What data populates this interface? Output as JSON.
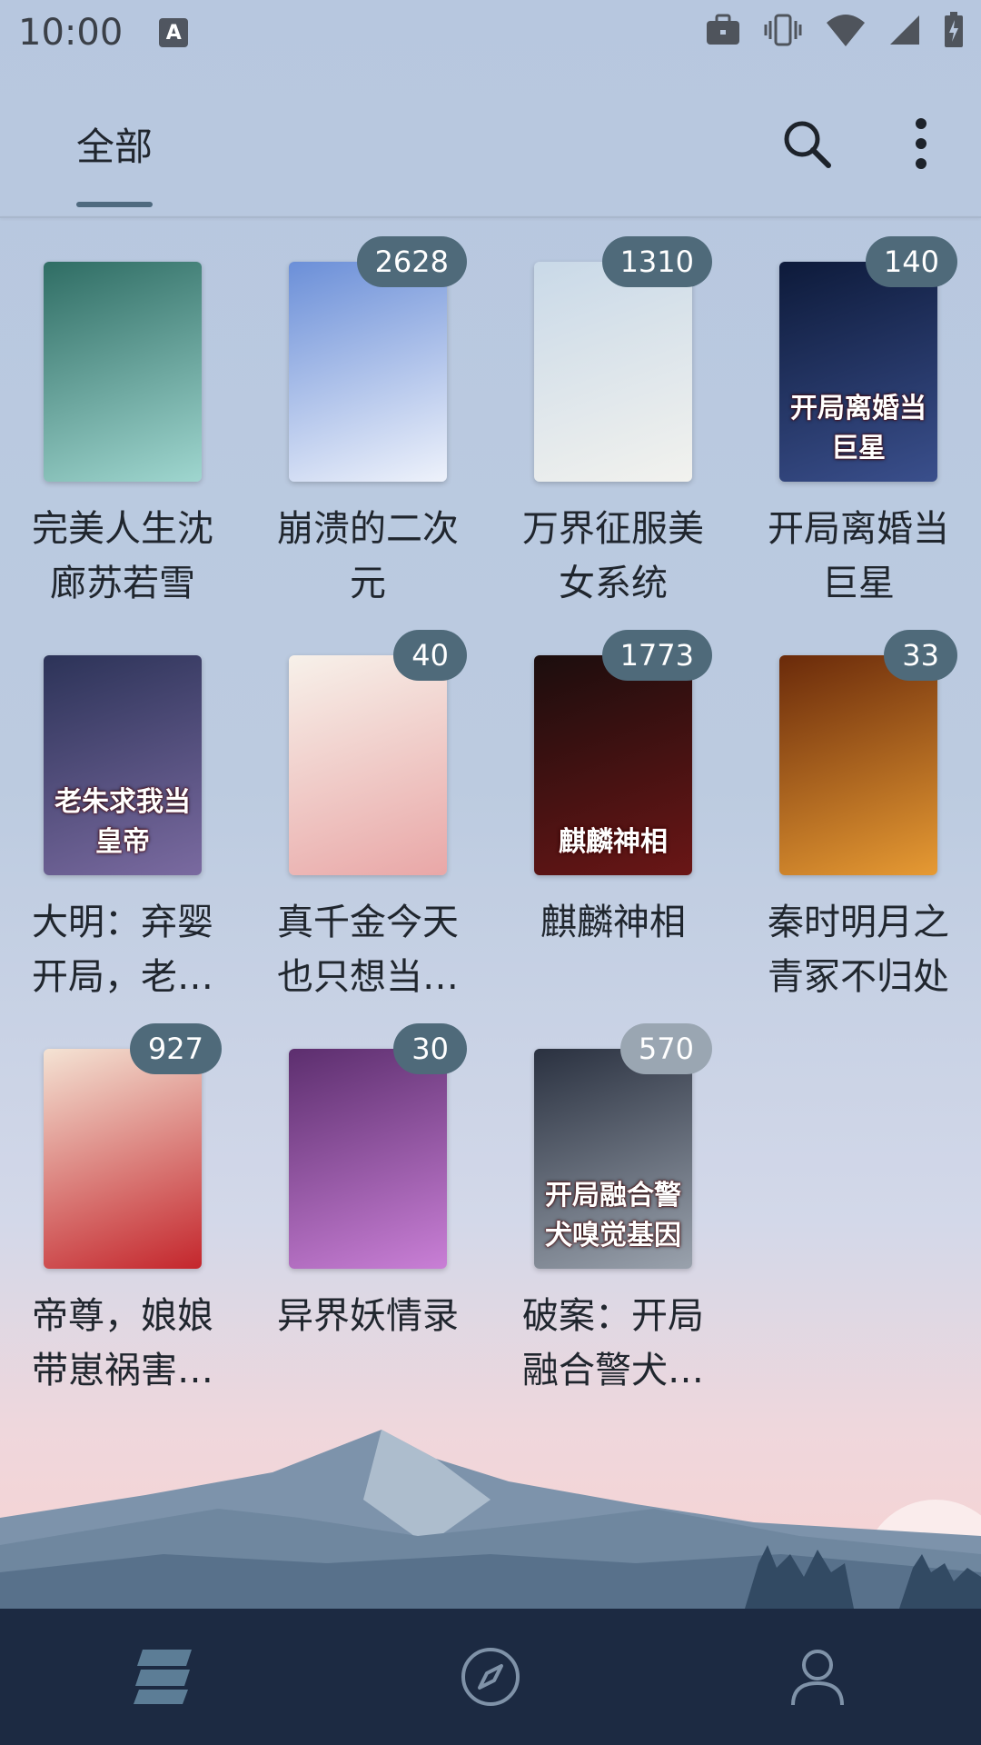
{
  "status_bar": {
    "time": "10:00",
    "a_icon": "A"
  },
  "header": {
    "tab_label": "全部",
    "search_icon": "search-icon",
    "more_icon": "more-vert-icon"
  },
  "books": [
    {
      "title": "完美人生沈廊苏若雪",
      "badge": "",
      "cover_text": "",
      "colors": [
        "#2f6d64",
        "#9fd6cf"
      ]
    },
    {
      "title": "崩溃的二次元",
      "badge": "2628",
      "cover_text": "",
      "colors": [
        "#6b8fd8",
        "#eef2fb"
      ]
    },
    {
      "title": "万界征服美女系统",
      "badge": "1310",
      "cover_text": "",
      "colors": [
        "#c9d9e8",
        "#f2f2ee"
      ]
    },
    {
      "title": "开局离婚当巨星",
      "badge": "140",
      "cover_text": "开局离婚当巨星",
      "colors": [
        "#0d1a3a",
        "#3a4f8c"
      ]
    },
    {
      "title": "大明：弃婴开局，老朱求我当皇帝",
      "badge": "",
      "cover_text": "老朱求我当皇帝",
      "colors": [
        "#2c3358",
        "#7a6aa0"
      ]
    },
    {
      "title": "真千金今天也只想当咸鱼",
      "badge": "40",
      "cover_text": "",
      "colors": [
        "#f7f1ea",
        "#e9a7a7"
      ]
    },
    {
      "title": "麒麟神相",
      "badge": "1773",
      "cover_text": "麒麟神相",
      "colors": [
        "#1b0d0d",
        "#6a1616"
      ]
    },
    {
      "title": "秦时明月之青冢不归处",
      "badge": "33",
      "cover_text": "",
      "colors": [
        "#6a2a0a",
        "#e69a33"
      ]
    },
    {
      "title": "帝尊，娘娘带崽祸害三界了",
      "badge": "927",
      "cover_text": "",
      "colors": [
        "#f4e3d4",
        "#c4262c"
      ]
    },
    {
      "title": "异界妖情录",
      "badge": "30",
      "cover_text": "",
      "colors": [
        "#5c2e6e",
        "#c97fd6"
      ]
    },
    {
      "title": "破案：开局融合警犬嗅觉基因",
      "badge": "570",
      "cover_text": "开局融合警犬嗅觉基因",
      "colors": [
        "#2a3140",
        "#9aa2ad"
      ]
    }
  ],
  "bottom_nav": {
    "items": [
      "bookshelf-icon",
      "discover-compass-icon",
      "profile-icon"
    ]
  }
}
